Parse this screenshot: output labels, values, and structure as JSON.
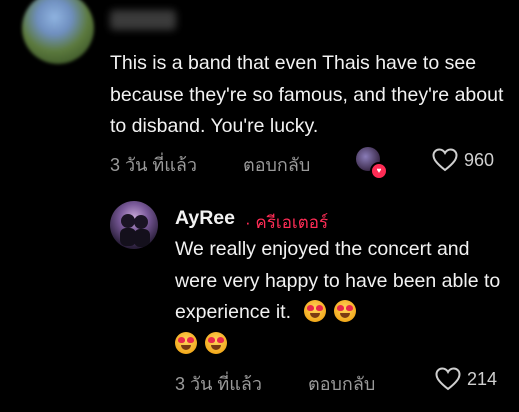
{
  "comment": {
    "text": "This is a band that even Thais have to see because they're so famous, and they're about to disband. You're lucky.",
    "time": "3 วัน ที่แล้ว",
    "reply_label": "ตอบกลับ",
    "likes": "960"
  },
  "reply": {
    "author": "AyRee",
    "badge": "· ครีเอเตอร์",
    "text": "We really enjoyed the concert and were very happy to have been able to experience it.",
    "time": "3 วัน ที่แล้ว",
    "reply_label": "ตอบกลับ",
    "likes": "214"
  },
  "icons": {
    "like": "heart-outline-icon",
    "emoji": "heart-eyes-emoji-icon",
    "liked_by_creator": "creator-liked-heart-icon"
  },
  "colors": {
    "background": "#000000",
    "text": "#f2f2f2",
    "meta": "#9a9a9a",
    "accent": "#fe2c55"
  }
}
